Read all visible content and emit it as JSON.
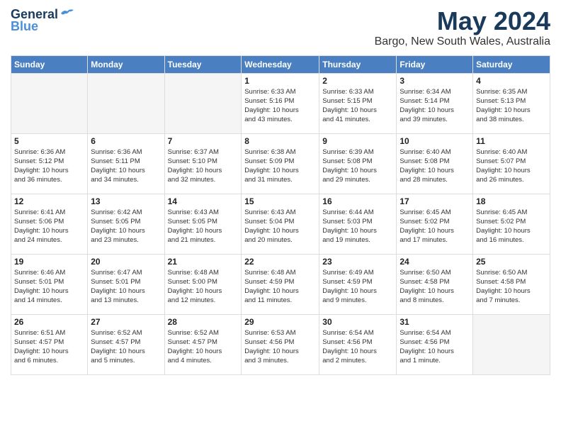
{
  "logo": {
    "general": "General",
    "blue": "Blue"
  },
  "header": {
    "month": "May 2024",
    "location": "Bargo, New South Wales, Australia"
  },
  "weekdays": [
    "Sunday",
    "Monday",
    "Tuesday",
    "Wednesday",
    "Thursday",
    "Friday",
    "Saturday"
  ],
  "weeks": [
    [
      {
        "day": "",
        "info": ""
      },
      {
        "day": "",
        "info": ""
      },
      {
        "day": "",
        "info": ""
      },
      {
        "day": "1",
        "info": "Sunrise: 6:33 AM\nSunset: 5:16 PM\nDaylight: 10 hours\nand 43 minutes."
      },
      {
        "day": "2",
        "info": "Sunrise: 6:33 AM\nSunset: 5:15 PM\nDaylight: 10 hours\nand 41 minutes."
      },
      {
        "day": "3",
        "info": "Sunrise: 6:34 AM\nSunset: 5:14 PM\nDaylight: 10 hours\nand 39 minutes."
      },
      {
        "day": "4",
        "info": "Sunrise: 6:35 AM\nSunset: 5:13 PM\nDaylight: 10 hours\nand 38 minutes."
      }
    ],
    [
      {
        "day": "5",
        "info": "Sunrise: 6:36 AM\nSunset: 5:12 PM\nDaylight: 10 hours\nand 36 minutes."
      },
      {
        "day": "6",
        "info": "Sunrise: 6:36 AM\nSunset: 5:11 PM\nDaylight: 10 hours\nand 34 minutes."
      },
      {
        "day": "7",
        "info": "Sunrise: 6:37 AM\nSunset: 5:10 PM\nDaylight: 10 hours\nand 32 minutes."
      },
      {
        "day": "8",
        "info": "Sunrise: 6:38 AM\nSunset: 5:09 PM\nDaylight: 10 hours\nand 31 minutes."
      },
      {
        "day": "9",
        "info": "Sunrise: 6:39 AM\nSunset: 5:08 PM\nDaylight: 10 hours\nand 29 minutes."
      },
      {
        "day": "10",
        "info": "Sunrise: 6:40 AM\nSunset: 5:08 PM\nDaylight: 10 hours\nand 28 minutes."
      },
      {
        "day": "11",
        "info": "Sunrise: 6:40 AM\nSunset: 5:07 PM\nDaylight: 10 hours\nand 26 minutes."
      }
    ],
    [
      {
        "day": "12",
        "info": "Sunrise: 6:41 AM\nSunset: 5:06 PM\nDaylight: 10 hours\nand 24 minutes."
      },
      {
        "day": "13",
        "info": "Sunrise: 6:42 AM\nSunset: 5:05 PM\nDaylight: 10 hours\nand 23 minutes."
      },
      {
        "day": "14",
        "info": "Sunrise: 6:43 AM\nSunset: 5:05 PM\nDaylight: 10 hours\nand 21 minutes."
      },
      {
        "day": "15",
        "info": "Sunrise: 6:43 AM\nSunset: 5:04 PM\nDaylight: 10 hours\nand 20 minutes."
      },
      {
        "day": "16",
        "info": "Sunrise: 6:44 AM\nSunset: 5:03 PM\nDaylight: 10 hours\nand 19 minutes."
      },
      {
        "day": "17",
        "info": "Sunrise: 6:45 AM\nSunset: 5:02 PM\nDaylight: 10 hours\nand 17 minutes."
      },
      {
        "day": "18",
        "info": "Sunrise: 6:45 AM\nSunset: 5:02 PM\nDaylight: 10 hours\nand 16 minutes."
      }
    ],
    [
      {
        "day": "19",
        "info": "Sunrise: 6:46 AM\nSunset: 5:01 PM\nDaylight: 10 hours\nand 14 minutes."
      },
      {
        "day": "20",
        "info": "Sunrise: 6:47 AM\nSunset: 5:01 PM\nDaylight: 10 hours\nand 13 minutes."
      },
      {
        "day": "21",
        "info": "Sunrise: 6:48 AM\nSunset: 5:00 PM\nDaylight: 10 hours\nand 12 minutes."
      },
      {
        "day": "22",
        "info": "Sunrise: 6:48 AM\nSunset: 4:59 PM\nDaylight: 10 hours\nand 11 minutes."
      },
      {
        "day": "23",
        "info": "Sunrise: 6:49 AM\nSunset: 4:59 PM\nDaylight: 10 hours\nand 9 minutes."
      },
      {
        "day": "24",
        "info": "Sunrise: 6:50 AM\nSunset: 4:58 PM\nDaylight: 10 hours\nand 8 minutes."
      },
      {
        "day": "25",
        "info": "Sunrise: 6:50 AM\nSunset: 4:58 PM\nDaylight: 10 hours\nand 7 minutes."
      }
    ],
    [
      {
        "day": "26",
        "info": "Sunrise: 6:51 AM\nSunset: 4:57 PM\nDaylight: 10 hours\nand 6 minutes."
      },
      {
        "day": "27",
        "info": "Sunrise: 6:52 AM\nSunset: 4:57 PM\nDaylight: 10 hours\nand 5 minutes."
      },
      {
        "day": "28",
        "info": "Sunrise: 6:52 AM\nSunset: 4:57 PM\nDaylight: 10 hours\nand 4 minutes."
      },
      {
        "day": "29",
        "info": "Sunrise: 6:53 AM\nSunset: 4:56 PM\nDaylight: 10 hours\nand 3 minutes."
      },
      {
        "day": "30",
        "info": "Sunrise: 6:54 AM\nSunset: 4:56 PM\nDaylight: 10 hours\nand 2 minutes."
      },
      {
        "day": "31",
        "info": "Sunrise: 6:54 AM\nSunset: 4:56 PM\nDaylight: 10 hours\nand 1 minute."
      },
      {
        "day": "",
        "info": ""
      }
    ]
  ]
}
